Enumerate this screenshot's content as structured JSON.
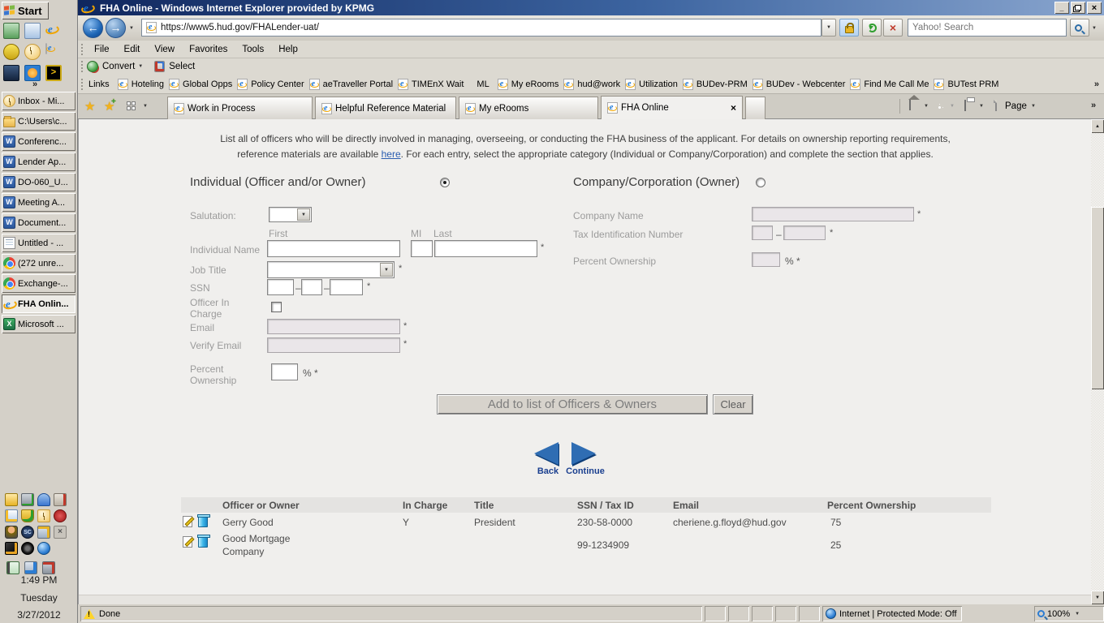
{
  "icons": {
    "dropdown": "▼",
    "back_arrow": "←",
    "forward_arrow": "→",
    "star": "★",
    "close": "×",
    "stop": "×",
    "minimize": "_",
    "chevron": "»",
    "back_triangle": "◀",
    "continue_triangle": "▶"
  },
  "taskbar": {
    "start": "Start",
    "chevron": "»",
    "buttons": [
      {
        "label": "Inbox - Mi..."
      },
      {
        "label": "C:\\Users\\c..."
      },
      {
        "label": "Conferenc..."
      },
      {
        "label": "Lender Ap..."
      },
      {
        "label": "DO-060_U..."
      },
      {
        "label": "Meeting A..."
      },
      {
        "label": "Document..."
      },
      {
        "label": "Untitled - ..."
      },
      {
        "label": "(272 unre..."
      },
      {
        "label": "Exchange-..."
      },
      {
        "label": "FHA Onlin..."
      },
      {
        "label": "Microsoft ..."
      }
    ],
    "clock": {
      "time": "1:49 PM",
      "day": "Tuesday",
      "date": "3/27/2012"
    }
  },
  "browser": {
    "title": "FHA Online - Windows Internet Explorer provided by KPMG",
    "address": "https://www5.hud.gov/FHALender-uat/",
    "search_placeholder": "Yahoo! Search",
    "menu": [
      "File",
      "Edit",
      "View",
      "Favorites",
      "Tools",
      "Help"
    ],
    "convert_label": "Convert",
    "select_label": "Select",
    "links_label": "Links",
    "links": [
      "Hoteling",
      "Global Opps",
      "Policy Center",
      "aeTraveller Portal",
      "TIMEnX Wait",
      "ML",
      "My eRooms",
      "hud@work",
      "Utilization",
      "BUDev-PRM",
      "BUDev - Webcenter",
      "Find Me Call Me",
      "BUTest PRM"
    ],
    "tabs": [
      "Work in Process",
      "Helpful Reference Material",
      "My eRooms",
      "FHA Online"
    ],
    "page_label": "Page",
    "status_done": "Done",
    "status_zone": "Internet | Protected Mode: Off",
    "status_zoom": "100%"
  },
  "page": {
    "intro_line1": "List all of officers who will be directly involved in managing, overseeing, or conducting the FHA business of the applicant. For details on ownership reporting requirements,",
    "intro_pre": "reference materials are available ",
    "intro_link": "here",
    "intro_post": ". For each entry, select the appropriate category (Individual or Company/Corporation) and complete the section that applies.",
    "required": "*",
    "dash": "–",
    "individual": {
      "heading": "Individual (Officer and/or Owner)",
      "salutation": "Salutation:",
      "first": "First",
      "mi": "MI",
      "last": "Last",
      "name": "Individual Name",
      "job_title": "Job Title",
      "ssn": "SSN",
      "officer_line1": "Officer In",
      "officer_line2": "Charge",
      "email": "Email",
      "verify_email": "Verify Email",
      "percent_line1": "Percent",
      "percent_line2": "Ownership",
      "percent_suffix": "% *"
    },
    "company": {
      "heading": "Company/Corporation (Owner)",
      "name": "Company Name",
      "tax_id": "Tax Identification Number",
      "percent": "Percent Ownership",
      "percent_suffix": "% *"
    },
    "add_button": "Add to list of Officers & Owners",
    "clear_button": "Clear",
    "back_label": "Back",
    "continue_label": "Continue",
    "table": {
      "headers": [
        "Officer or Owner",
        "In Charge",
        "Title",
        "SSN / Tax ID",
        "Email",
        "Percent Ownership"
      ],
      "rows": [
        {
          "name": "Gerry Good",
          "in_charge": "Y",
          "title": "President",
          "ssn": "230-58-0000",
          "email": "cheriene.g.floyd@hud.gov",
          "percent": "75"
        },
        {
          "name": "Good Mortgage Company",
          "in_charge": "",
          "title": "",
          "ssn": "99-1234909",
          "email": "",
          "percent": "25"
        }
      ]
    }
  }
}
